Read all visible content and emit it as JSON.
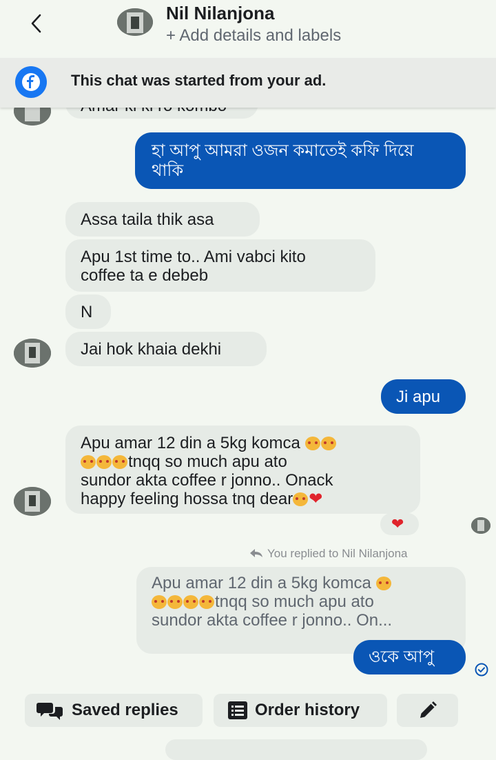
{
  "header": {
    "contact_name": "Nil Nilanjona",
    "subtitle": "+ Add details and labels"
  },
  "banner": {
    "text": "This chat was started from your ad."
  },
  "messages": {
    "cut_off": "Amar ki ki ro kombo",
    "out1": "হা আপু আমরা ওজন কমাতেই কফি দিয়ে থাকি",
    "in1": "Assa taila thik asa",
    "in2_line1": "Apu 1st time to.. Ami vabci kito",
    "in2_line2": "coffee ta e debeb",
    "in3": "N",
    "in4": "Jai hok khaia dekhi",
    "out2": "Ji apu",
    "in5_line1": "Apu amar 12 din a 5kg komca",
    "in5_line2": "tnqq so much apu ato",
    "in5_line3": "sundor akta coffee r jonno.. Onack",
    "in5_line4": "happy feeling hossa tnq dear",
    "reaction": "❤",
    "replied_label": "You replied to Nil Nilanjona",
    "quote_line1": "Apu amar 12 din a 5kg komca",
    "quote_line2": "tnqq so much apu ato",
    "quote_line3": "sundor akta coffee r jonno.. On...",
    "out3": "ওকে আপু",
    "seen_icon": "check-circle-icon"
  },
  "quick_replies": {
    "saved_replies": "Saved replies",
    "order_history": "Order history",
    "edit_icon": "pencil-icon"
  },
  "colors": {
    "outgoing": "#0a56b5",
    "incoming": "#e6ebe6",
    "facebook": "#1877f2",
    "background": "#f3f7f1"
  }
}
